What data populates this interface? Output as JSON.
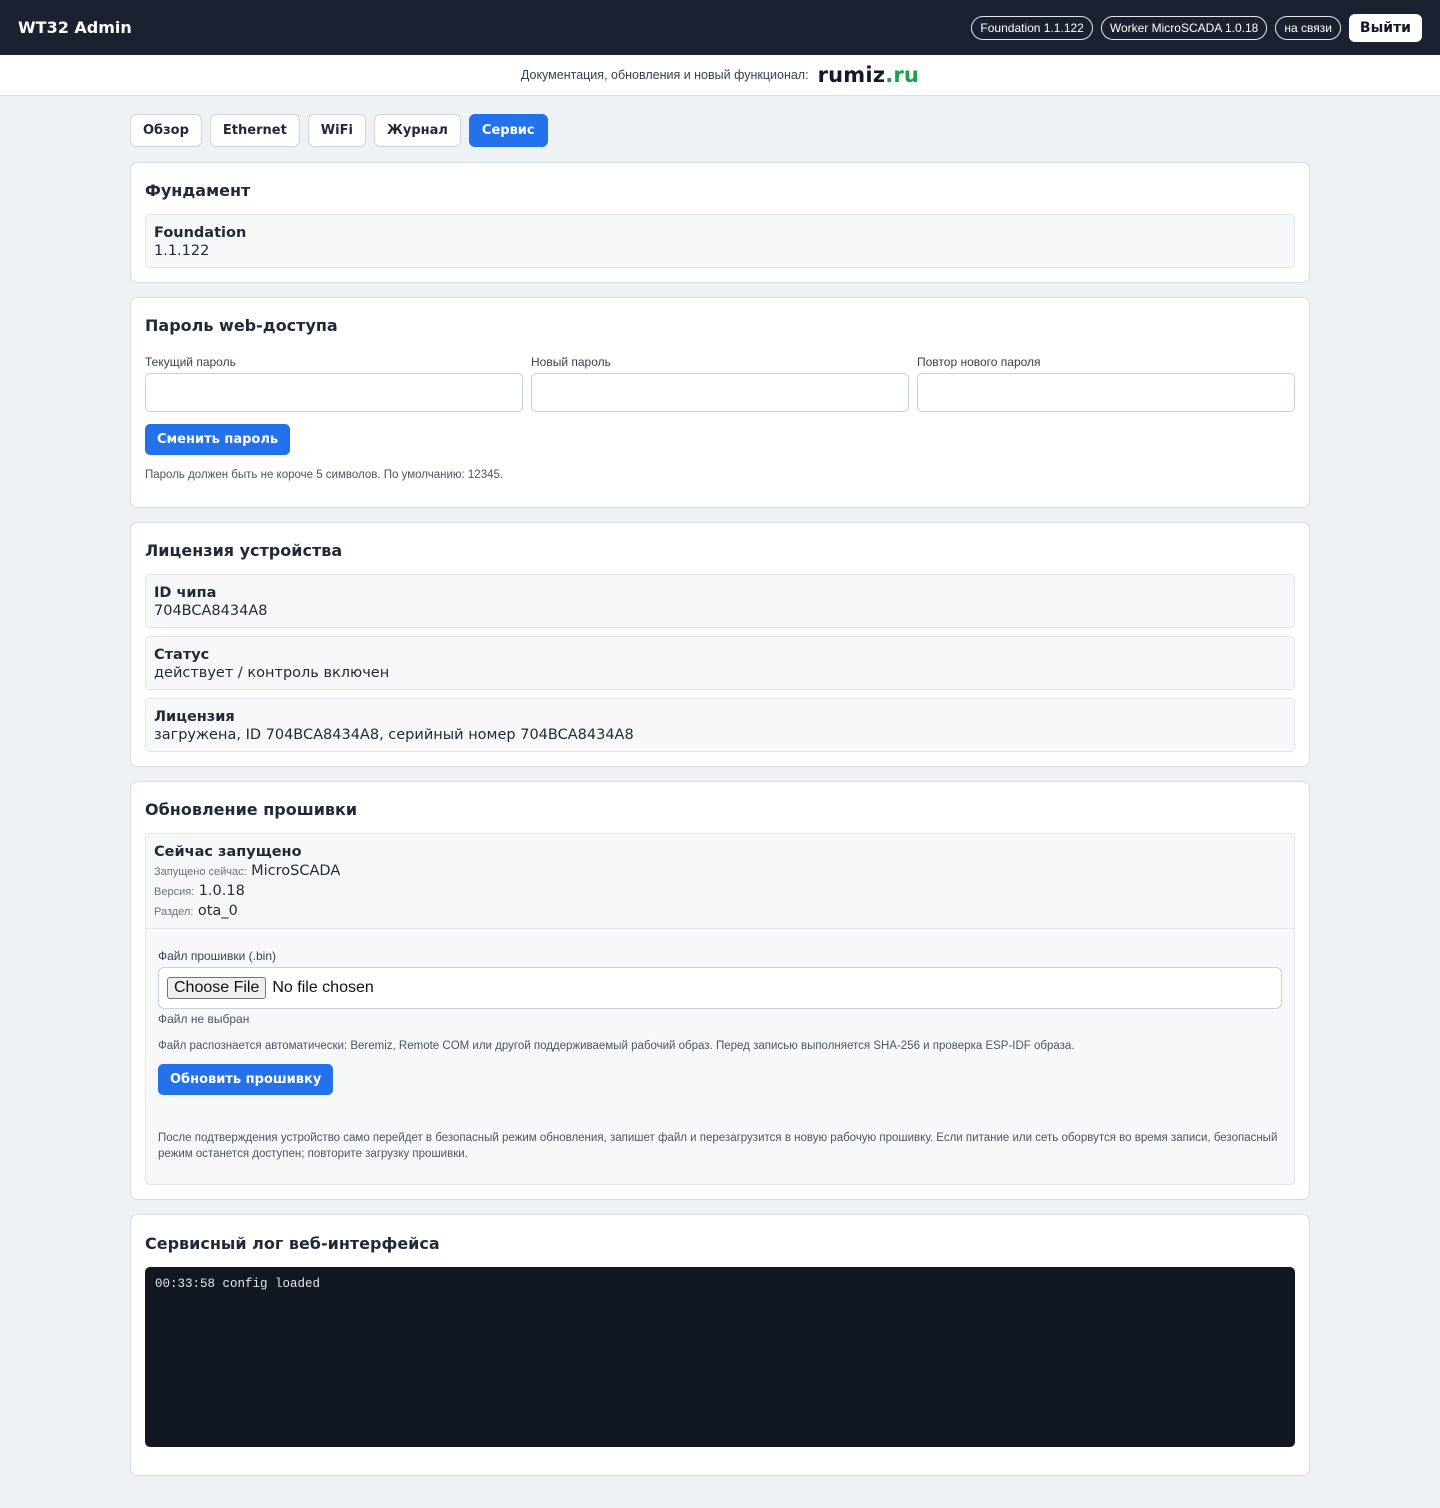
{
  "header": {
    "title": "WT32 Admin",
    "foundation_badge": "Foundation 1.1.122",
    "worker_badge": "Worker MicroSCADA 1.0.18",
    "connection_badge": "на связи",
    "logout_label": "Выйти"
  },
  "promo": {
    "text": "Документация, обновления и новый функционал:",
    "logo_main": "rumiz",
    "logo_dot": ".",
    "logo_tld": "ru"
  },
  "tabs": [
    {
      "label": "Обзор",
      "active": false
    },
    {
      "label": "Ethernet",
      "active": false
    },
    {
      "label": "WiFi",
      "active": false
    },
    {
      "label": "Журнал",
      "active": false
    },
    {
      "label": "Сервис",
      "active": true
    }
  ],
  "foundation": {
    "title": "Фундамент",
    "name": "Foundation",
    "version": "1.1.122"
  },
  "password": {
    "title": "Пароль web-доступа",
    "current_label": "Текущий пароль",
    "current_value": "",
    "new_label": "Новый пароль",
    "new_value": "",
    "repeat_label": "Повтор нового пароля",
    "repeat_value": "",
    "submit_label": "Сменить пароль",
    "hint": "Пароль должен быть не короче 5 символов. По умолчанию: 12345."
  },
  "license": {
    "title": "Лицензия устройства",
    "chip_label": "ID чипа",
    "chip_value": "704BCA8434A8",
    "status_label": "Статус",
    "status_value": "действует / контроль включен",
    "license_label": "Лицензия",
    "license_value": "загружена, ID 704BCA8434A8, серийный номер 704BCA8434A8"
  },
  "firmware": {
    "title": "Обновление прошивки",
    "running_label": "Сейчас запущено",
    "running_now_label": "Запущено сейчас:",
    "running_now_value": "MicroSCADA",
    "version_label": "Версия:",
    "version_value": "1.0.18",
    "partition_label": "Раздел:",
    "partition_value": "ota_0",
    "file_label": "Файл прошивки (.bin)",
    "choose_file_label": "Choose File",
    "file_chosen_text": "No file chosen",
    "file_status": "Файл не выбран",
    "detect_hint": "Файл распознается автоматически: Beremiz, Remote COM или другой поддерживаемый рабочий образ. Перед записью выполняется SHA-256 и проверка ESP-IDF образа.",
    "submit_label": "Обновить прошивку",
    "after_note": "После подтверждения устройство само перейдет в безопасный режим обновления, запишет файл и перезагрузится в новую рабочую прошивку. Если питание или сеть оборвутся во время записи, безопасный режим останется доступен; повторите загрузку прошивки."
  },
  "service_log": {
    "title": "Сервисный лог веб-интерфейса",
    "lines": [
      "00:33:58 config loaded"
    ]
  },
  "colors": {
    "header_bg": "#1a2232",
    "accent": "#2372eb",
    "brand_green": "#16a34a",
    "log_bg": "#111821"
  }
}
